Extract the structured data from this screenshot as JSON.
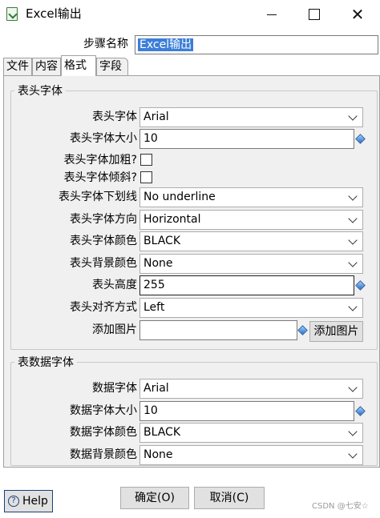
{
  "window": {
    "title": "Excel输出",
    "icon": "excel-app-icon",
    "controls": {
      "minimize": "minimize-icon",
      "maximize": "maximize-icon",
      "close": "close-icon",
      "close_glyph": "✕"
    }
  },
  "step": {
    "label": "步骤名称",
    "value": "Excel输出"
  },
  "tabs": [
    {
      "label": "文件",
      "active": false
    },
    {
      "label": "内容",
      "active": false
    },
    {
      "label": "格式",
      "active": true
    },
    {
      "label": "字段",
      "active": false
    }
  ],
  "header_font_group": {
    "title": "表头字体",
    "font_label": "表头字体",
    "font_value": "Arial",
    "size_label": "表头字体大小",
    "size_value": "10",
    "bold_label": "表头字体加粗?",
    "bold_checked": false,
    "italic_label": "表头字体倾斜?",
    "italic_checked": false,
    "underline_label": "表头字体下划线",
    "underline_value": "No underline",
    "orientation_label": "表头字体方向",
    "orientation_value": "Horizontal",
    "color_label": "表头字体颜色",
    "color_value": "BLACK",
    "bg_label": "表头背景颜色",
    "bg_value": "None",
    "height_label": "表头高度",
    "height_value": "255",
    "align_label": "表头对齐方式",
    "align_value": "Left",
    "image_label": "添加图片",
    "image_value": "",
    "image_button": "添加图片"
  },
  "data_font_group": {
    "title": "表数据字体",
    "font_label": "数据字体",
    "font_value": "Arial",
    "size_label": "数据字体大小",
    "size_value": "10",
    "color_label": "数据字体颜色",
    "color_value": "BLACK",
    "bg_label": "数据背景颜色",
    "bg_value": "None"
  },
  "footer": {
    "help_label": "Help",
    "help_glyph": "?",
    "ok_label": "确定(O)",
    "cancel_label": "取消(C)"
  },
  "watermark": "CSDN @七安☆",
  "colors": {
    "selection": "#3b7ed8",
    "panel": "#f0f0f0",
    "button": "#e1e1e1"
  }
}
